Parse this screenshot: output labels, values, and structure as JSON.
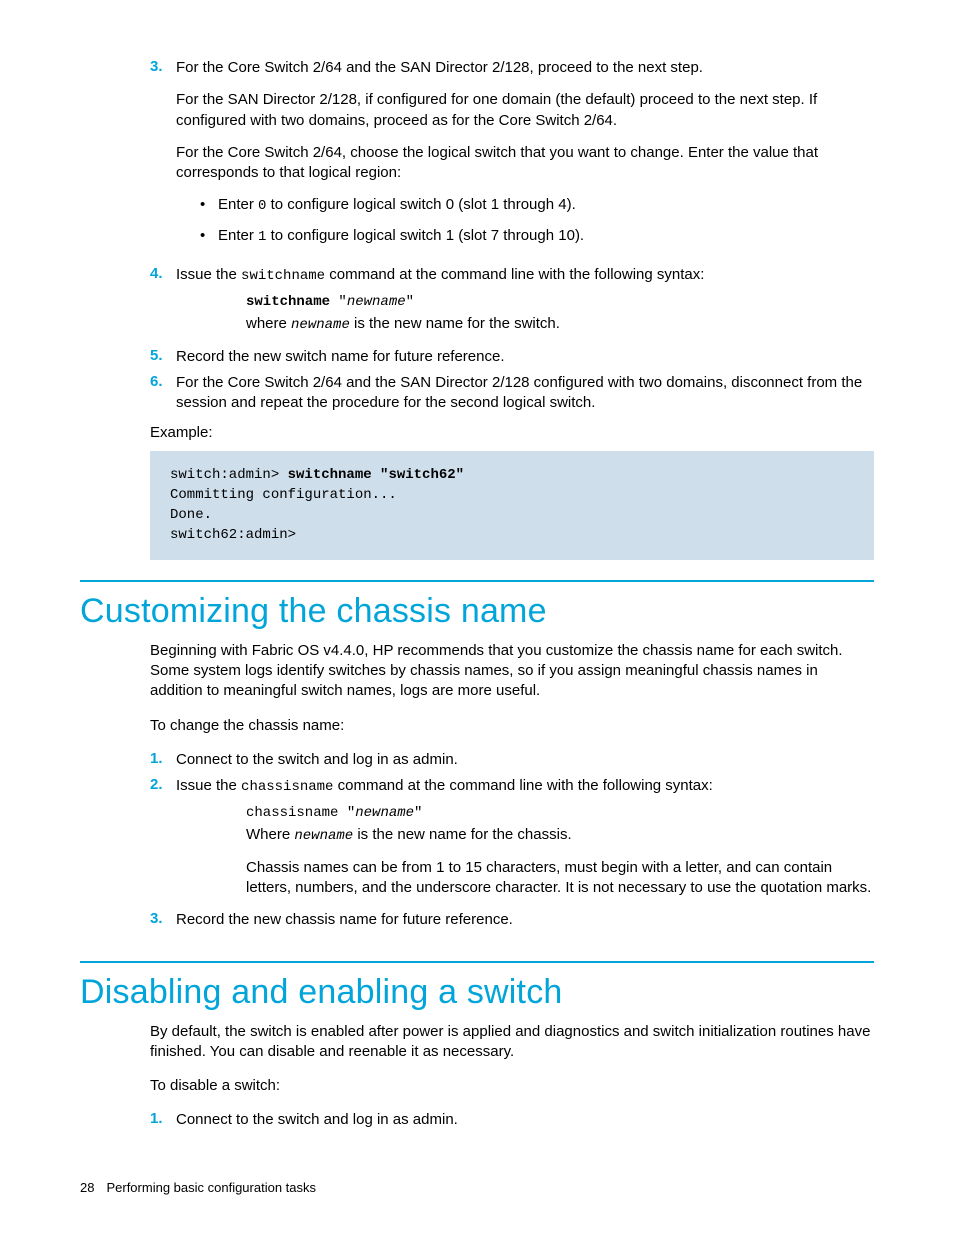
{
  "steps_first": {
    "s3": {
      "num": "3.",
      "p1": "For the Core Switch 2/64 and the SAN Director 2/128, proceed to the next step.",
      "p2": "For the SAN Director 2/128, if configured for one domain (the default) proceed to the next step. If configured with two domains, proceed as for the Core Switch 2/64.",
      "p3": "For the Core Switch 2/64, choose the logical switch that you want to change. Enter the value that corresponds to that logical region:",
      "b1_pre": "Enter ",
      "b1_code": "0",
      "b1_post": " to configure logical switch 0 (slot 1 through 4).",
      "b2_pre": "Enter ",
      "b2_code": "1",
      "b2_post": " to configure logical switch 1 (slot 7 through 10)."
    },
    "s4": {
      "num": "4.",
      "pre": "Issue the ",
      "cmd": "switchname",
      "post": " command at the command line with the following syntax:",
      "syntax_bold": "switchname",
      "syntax_q1": " \"",
      "syntax_arg": "newname",
      "syntax_q2": "\"",
      "where_pre": "where ",
      "where_arg": "newname",
      "where_post": " is the new name for the switch."
    },
    "s5": {
      "num": "5.",
      "text": "Record the new switch name for future reference."
    },
    "s6": {
      "num": "6.",
      "text": "For the Core Switch 2/64 and the SAN Director 2/128 configured with two domains, disconnect from the session and repeat the procedure for the second logical switch."
    }
  },
  "example_label": "Example:",
  "code1": {
    "l1a": "switch:admin> ",
    "l1b": "switchname \"switch62\"",
    "l2": "Committing configuration...",
    "l3": "Done.",
    "l4": "switch62:admin>"
  },
  "section1": {
    "title": "Customizing the chassis name",
    "intro": "Beginning with Fabric OS v4.4.0, HP recommends that you customize the chassis name for each switch. Some system logs identify switches by chassis names, so if you assign meaningful chassis names in addition to meaningful switch names, logs are more useful.",
    "lead": "To change the chassis name:",
    "s1": {
      "num": "1.",
      "text": "Connect to the switch and log in as admin."
    },
    "s2": {
      "num": "2.",
      "pre": "Issue the ",
      "cmd": "chassisname",
      "post": " command at the command line with the following syntax:",
      "syntax_cmd": "chassisname",
      "syntax_q1": " \"",
      "syntax_arg": "newname",
      "syntax_q2": "\"",
      "where_pre": "Where ",
      "where_arg": "newname",
      "where_post": " is the new name for the chassis.",
      "rules": "Chassis names can be from 1 to 15 characters, must begin with a letter, and can contain letters, numbers, and the underscore character. It is not necessary to use the quotation marks."
    },
    "s3": {
      "num": "3.",
      "text": "Record the new chassis name for future reference."
    }
  },
  "section2": {
    "title": "Disabling and enabling a switch",
    "intro": "By default, the switch is enabled after power is applied and diagnostics and switch initialization routines have finished. You can disable and reenable it as necessary.",
    "lead": "To disable a switch:",
    "s1": {
      "num": "1.",
      "text": "Connect to the switch and log in as admin."
    }
  },
  "footer": {
    "page": "28",
    "title": "Performing basic configuration tasks"
  }
}
